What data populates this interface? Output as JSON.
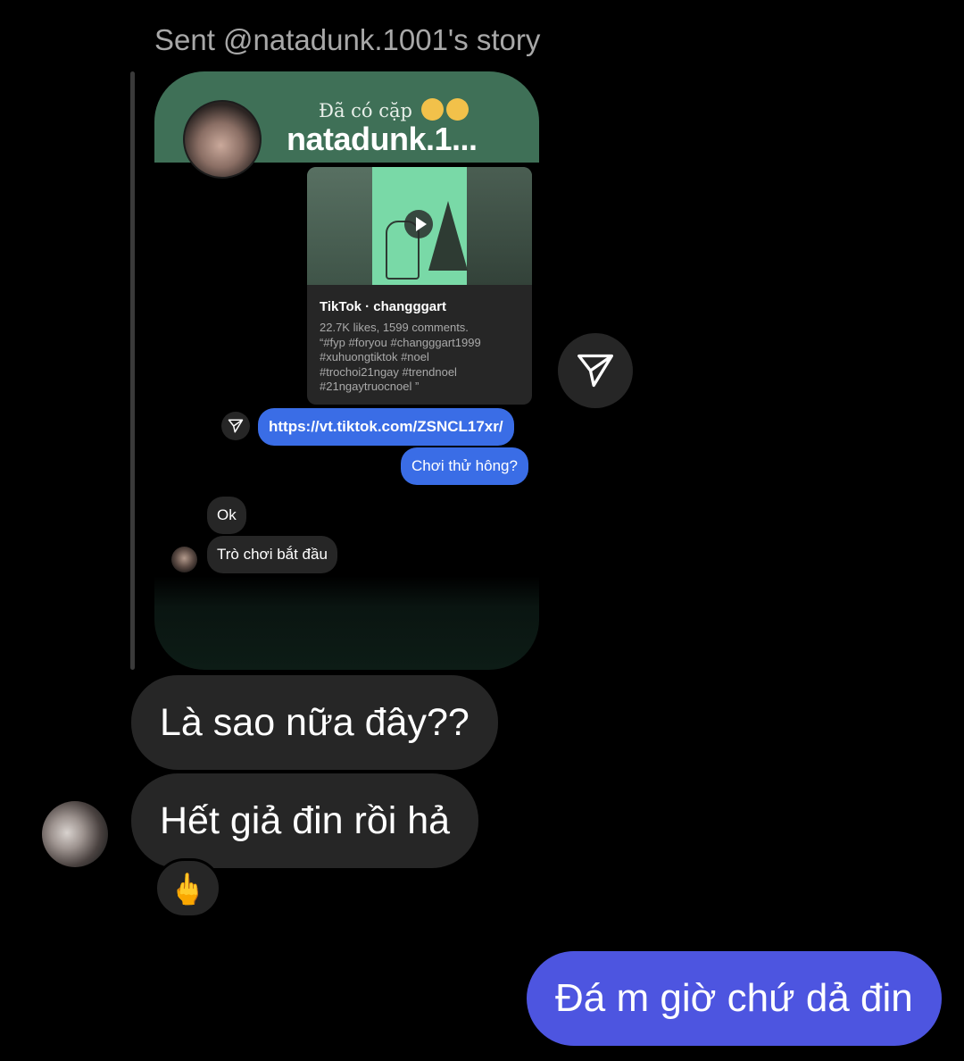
{
  "header": {
    "sent_label": "Sent @natadunk.1001's story"
  },
  "story": {
    "caption": "Đã có cặp",
    "username": "natadunk.1...",
    "share_card": {
      "title": "TikTok · changggart",
      "meta_lines": [
        "22.7K likes, 1599 comments.",
        "“#fyp #foryou #changggart1999",
        "#xuhuongtiktok #noel",
        "#trochoi21ngay #trendnoel",
        "#21ngaytruocnoel ”"
      ]
    },
    "messages": {
      "link": "https://vt.tiktok.com/ZSNCL17xr/",
      "question": "Chơi thử hông?",
      "reply_ok": "Ok",
      "reply_start": "Trò chơi bắt đầu"
    }
  },
  "chat": {
    "received": [
      "Là sao nữa đây??",
      "Hết giả đin rồi hả"
    ],
    "reaction": "🖕",
    "sent": "Đá m giờ chứ dả đin"
  },
  "icons": {
    "forward": "paper-plane-icon",
    "play": "play-icon"
  },
  "colors": {
    "background": "#000000",
    "received_bubble": "#262626",
    "sent_bubble": "#4d55e0",
    "link_bubble": "#3a6de6",
    "story_header": "#3f7057"
  }
}
